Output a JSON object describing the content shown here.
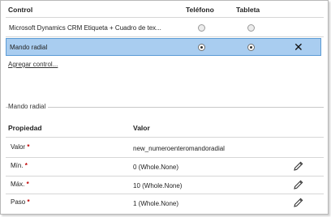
{
  "controls_table": {
    "headers": {
      "control": "Control",
      "phone": "Teléfono",
      "tablet": "Tableta"
    },
    "rows": [
      {
        "label": "Microsoft Dynamics CRM Etiqueta + Cuadro de tex...",
        "phone_checked": false,
        "tablet_checked": false,
        "selected": false
      },
      {
        "label": "Mando radial",
        "phone_checked": true,
        "tablet_checked": true,
        "selected": true,
        "close_icon": "close-icon"
      }
    ],
    "add_control_link": "Agregar control..."
  },
  "section": {
    "legend": "Mando radial",
    "headers": {
      "property": "Propiedad",
      "value": "Valor"
    },
    "properties": [
      {
        "label": "Valor",
        "required_mark": "*",
        "value": "new_numeroenteromandoradial",
        "editable": false
      },
      {
        "label": "Mín.",
        "required_mark": "*",
        "value": "0 (Whole.None)",
        "editable": true
      },
      {
        "label": "Máx.",
        "required_mark": "*",
        "value": "10 (Whole.None)",
        "editable": true
      },
      {
        "label": "Paso",
        "required_mark": "*",
        "value": "1 (Whole.None)",
        "editable": true
      }
    ]
  },
  "colors": {
    "selected_row_bg": "#a9cdf0",
    "selected_row_border": "#5b9bd5",
    "required": "#c00000"
  }
}
